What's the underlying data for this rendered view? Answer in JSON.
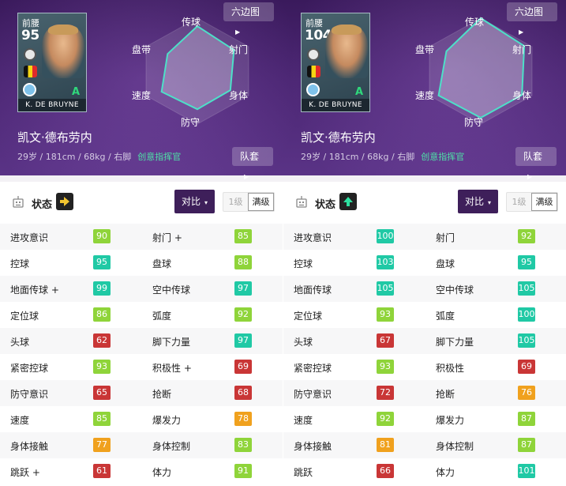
{
  "colors": {
    "header_bg": "#4b2673",
    "compare_button": "#3e1f5a",
    "stat_green": "#8fd43a",
    "stat_teal": "#20c9a5",
    "stat_red": "#c93636",
    "stat_orange": "#f0a11e",
    "role_text": "#4ee2a7"
  },
  "panels": [
    {
      "card": {
        "position": "前腰",
        "rating": "95",
        "name_plate": "K. DE BRUYNE",
        "grade": "A"
      },
      "player_name": "凯文·德布劳内",
      "info": "29岁 / 181cm / 68kg / 右脚",
      "role": "创意指挥官",
      "hexagon_button": "六边图",
      "kit_button": "队套",
      "radar_labels": {
        "top": "传球",
        "upper_left": "盘带",
        "upper_right": "射门",
        "lower_left": "速度",
        "lower_right": "身体",
        "bottom": "防守"
      },
      "radar_values": [
        0.85,
        0.8,
        0.72,
        0.72,
        0.78,
        0.65
      ],
      "status_label": "状态",
      "status_icon": "arrow-right-icon",
      "compare_button": "对比",
      "level_label": "1级",
      "max_label": "满级",
      "stats": [
        {
          "name1": "进攻意识",
          "val1": "90",
          "c1": "green-lt",
          "name2": "射门 +",
          "val2": "85",
          "c2": "green-lt"
        },
        {
          "name1": "控球",
          "val1": "95",
          "c1": "teal",
          "name2": "盘球",
          "val2": "88",
          "c2": "green-lt"
        },
        {
          "name1": "地面传球 +",
          "val1": "99",
          "c1": "teal",
          "name2": "空中传球",
          "val2": "97",
          "c2": "teal"
        },
        {
          "name1": "定位球",
          "val1": "86",
          "c1": "green-lt",
          "name2": "弧度",
          "val2": "92",
          "c2": "green-lt"
        },
        {
          "name1": "头球",
          "val1": "62",
          "c1": "red",
          "name2": "脚下力量",
          "val2": "97",
          "c2": "teal"
        },
        {
          "name1": "紧密控球",
          "val1": "93",
          "c1": "green-lt",
          "name2": "积极性 +",
          "val2": "69",
          "c2": "red"
        },
        {
          "name1": "防守意识",
          "val1": "65",
          "c1": "red",
          "name2": "抢断",
          "val2": "68",
          "c2": "red"
        },
        {
          "name1": "速度",
          "val1": "85",
          "c1": "green-lt",
          "name2": "爆发力",
          "val2": "78",
          "c2": "orange"
        },
        {
          "name1": "身体接触",
          "val1": "77",
          "c1": "orange",
          "name2": "身体控制",
          "val2": "83",
          "c2": "green-lt"
        },
        {
          "name1": "跳跃 +",
          "val1": "61",
          "c1": "red",
          "name2": "体力",
          "val2": "91",
          "c2": "green-lt"
        }
      ]
    },
    {
      "card": {
        "position": "前腰",
        "rating": "104",
        "name_plate": "K. DE BRUYNE",
        "grade": "A"
      },
      "player_name": "凯文·德布劳内",
      "info": "29岁 / 181cm / 68kg / 右脚",
      "role": "创意指挥官",
      "hexagon_button": "六边图",
      "kit_button": "队套",
      "radar_labels": {
        "top": "传球",
        "upper_left": "盘带",
        "upper_right": "射门",
        "lower_left": "速度",
        "lower_right": "身体",
        "bottom": "防守"
      },
      "radar_values": [
        1.0,
        0.95,
        0.9,
        0.88,
        0.92,
        0.75
      ],
      "status_label": "状态",
      "status_icon": "arrow-up-icon",
      "compare_button": "对比",
      "level_label": "1级",
      "max_label": "满级",
      "stats": [
        {
          "name1": "进攻意识",
          "val1": "100",
          "c1": "teal",
          "name2": "射门",
          "val2": "92",
          "c2": "green-lt"
        },
        {
          "name1": "控球",
          "val1": "103",
          "c1": "teal",
          "name2": "盘球",
          "val2": "95",
          "c2": "teal"
        },
        {
          "name1": "地面传球",
          "val1": "105",
          "c1": "teal",
          "name2": "空中传球",
          "val2": "105",
          "c2": "teal"
        },
        {
          "name1": "定位球",
          "val1": "93",
          "c1": "green-lt",
          "name2": "弧度",
          "val2": "100",
          "c2": "teal"
        },
        {
          "name1": "头球",
          "val1": "67",
          "c1": "red",
          "name2": "脚下力量",
          "val2": "105",
          "c2": "teal"
        },
        {
          "name1": "紧密控球",
          "val1": "93",
          "c1": "green-lt",
          "name2": "积极性",
          "val2": "69",
          "c2": "red"
        },
        {
          "name1": "防守意识",
          "val1": "72",
          "c1": "red",
          "name2": "抢断",
          "val2": "76",
          "c2": "orange"
        },
        {
          "name1": "速度",
          "val1": "92",
          "c1": "green-lt",
          "name2": "爆发力",
          "val2": "87",
          "c2": "green-lt"
        },
        {
          "name1": "身体接触",
          "val1": "81",
          "c1": "orange",
          "name2": "身体控制",
          "val2": "87",
          "c2": "green-lt"
        },
        {
          "name1": "跳跃",
          "val1": "66",
          "c1": "red",
          "name2": "体力",
          "val2": "101",
          "c2": "teal"
        }
      ]
    }
  ]
}
